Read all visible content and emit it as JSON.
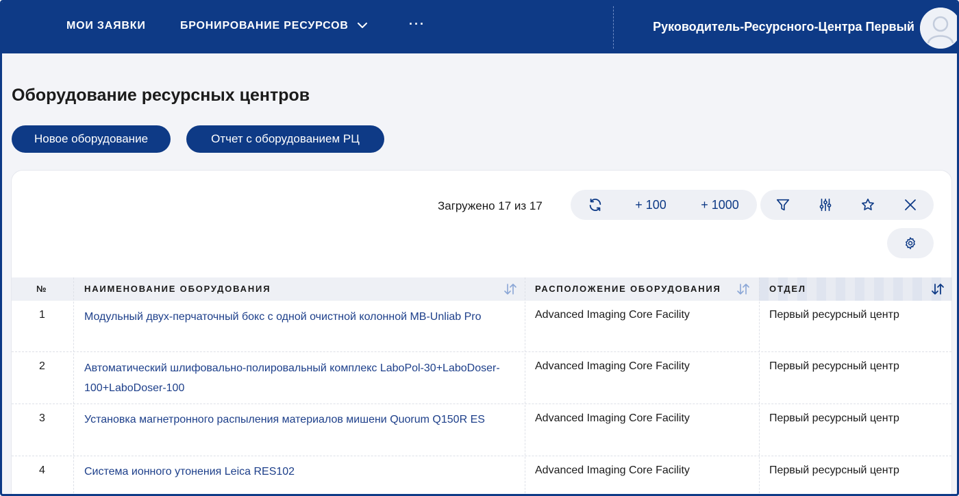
{
  "nav": {
    "my_requests": "МОИ ЗАЯВКИ",
    "booking": "БРОНИРОВАНИЕ РЕСУРСОВ",
    "more": "···",
    "user_name": "Руководитель-Ресурсного-Центра Первый"
  },
  "page": {
    "title": "Оборудование ресурсных центров",
    "new_button": "Новое оборудование",
    "report_button": "Отчет с оборудованием РЦ"
  },
  "toolbar": {
    "loaded_text": "Загружено 17 из 17",
    "plus_100": "+ 100",
    "plus_1000": "+ 1000"
  },
  "table": {
    "headers": {
      "num": "№",
      "name": "НАИМЕНОВАНИЕ ОБОРУДОВАНИЯ",
      "location": "РАСПОЛОЖЕНИЕ ОБОРУДОВАНИЯ",
      "department": "ОТДЕЛ"
    },
    "rows": [
      {
        "num": "1",
        "name": "Модульный двух-перчаточный бокс с одной очистной колонной MB-Unliab Pro",
        "location": "Advanced Imaging Core Facility",
        "department": "Первый ресурсный центр"
      },
      {
        "num": "2",
        "name": "Автоматический шлифовально-полировальный комплекс LaboPol-30+LaboDoser-100+LaboDoser-100",
        "location": "Advanced Imaging Core Facility",
        "department": "Первый ресурсный центр"
      },
      {
        "num": "3",
        "name": "Установка магнетронного распыления материалов мишени Quorum Q150R ES",
        "location": "Advanced Imaging Core Facility",
        "department": "Первый ресурсный центр"
      },
      {
        "num": "4",
        "name": "Система ионного утонения Leica RES102",
        "location": "Advanced Imaging Core Facility",
        "department": "Первый ресурсный центр"
      }
    ]
  },
  "colors": {
    "primary": "#0e3a86",
    "link": "#1d3f8a",
    "background": "#f3f4f8",
    "header_row": "#eef0f5"
  },
  "icons": {
    "booking_menu": "chevron-down-icon",
    "refresh": "refresh-icon",
    "filter": "filter-icon",
    "columns": "sliders-icon",
    "favorite": "star-icon",
    "clear": "close-icon",
    "settings": "gear-icon",
    "sort": "sort-icon",
    "user": "user-avatar-icon"
  }
}
